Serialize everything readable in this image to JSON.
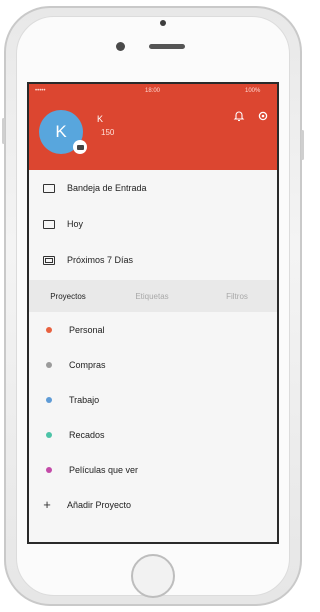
{
  "status": {
    "carrier": "•••••",
    "time": "18:00",
    "battery": "100%"
  },
  "user": {
    "initial": "K",
    "name": "K",
    "karma": "150"
  },
  "icons": {
    "notifications": "bell-icon",
    "settings": "gear-icon"
  },
  "nav": [
    {
      "label": "Bandeja de Entrada",
      "icon": "inbox-icon"
    },
    {
      "label": "Hoy",
      "icon": "calendar-icon"
    },
    {
      "label": "Próximos 7 Días",
      "icon": "calendar-week-icon"
    }
  ],
  "tabs": [
    "Proyectos",
    "Etiquetas",
    "Filtros"
  ],
  "projects": [
    {
      "label": "Personal",
      "color": "#e8613f"
    },
    {
      "label": "Compras",
      "color": "#9b9b9b"
    },
    {
      "label": "Trabajo",
      "color": "#5e9bd6"
    },
    {
      "label": "Recados",
      "color": "#4cc3a7"
    },
    {
      "label": "Películas que ver",
      "color": "#c34aa8"
    }
  ],
  "add_project": "Añadir Proyecto",
  "colors": {
    "header": "#dc4630",
    "avatar": "#58a6dd"
  }
}
